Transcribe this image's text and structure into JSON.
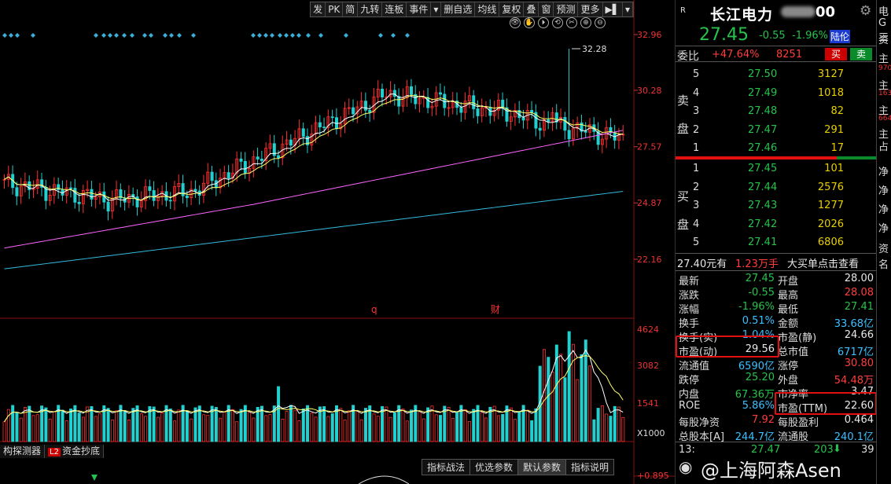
{
  "toolbar": {
    "buttons": [
      "发",
      "PK",
      "简",
      "九转",
      "连板",
      "事件",
      "▾",
      "删自选",
      "均线",
      "复权",
      "叠",
      "窗",
      "预测",
      "更多",
      "▶▌",
      "▾"
    ]
  },
  "mini_tools": [
    "👁",
    "✋",
    "⏵",
    "⟲",
    "✂",
    "⊕",
    "⊖"
  ],
  "chart": {
    "price_axis": [
      "32.96",
      "30.28",
      "27.57",
      "24.87",
      "22.16"
    ],
    "peak_label": "32.28",
    "event_markers": [
      "q",
      "财"
    ],
    "volume_axis": [
      "4624",
      "3082",
      "1541",
      "X1000"
    ],
    "sub_axis": [
      "+0.895"
    ],
    "colors": {
      "up": "#ff3030",
      "down": "#22d0d0",
      "ma5": "#ffffff",
      "ma10": "#ffff66",
      "ma60": "#ff66ff",
      "ma250": "#33bbdd"
    }
  },
  "bottom_tabs": {
    "tab1": "构探测器",
    "l2_badge": "L2",
    "tab2": "资金抄底",
    "indicator": [
      "指标战法",
      "优选参数",
      "默认参数",
      "指标说明"
    ]
  },
  "quote": {
    "badge": "R",
    "name": "长江电力",
    "code_tail": "00",
    "price": "27.45",
    "change": "-0.55",
    "change_pct": "-1.96%",
    "market_tag": "陆伦",
    "weibi_label": "委比",
    "weibi": "+47.64%",
    "weicha": "8251",
    "buy_btn": "买",
    "sell_btn": "卖",
    "sell_side_label": [
      "卖",
      "盘"
    ],
    "buy_side_label": [
      "买",
      "盘"
    ],
    "asks": [
      {
        "lvl": "5",
        "price": "27.50",
        "vol": "3127"
      },
      {
        "lvl": "4",
        "price": "27.49",
        "vol": "1018"
      },
      {
        "lvl": "3",
        "price": "27.48",
        "vol": "82"
      },
      {
        "lvl": "2",
        "price": "27.47",
        "vol": "291"
      },
      {
        "lvl": "1",
        "price": "27.46",
        "vol": "17"
      }
    ],
    "bids": [
      {
        "lvl": "1",
        "price": "27.45",
        "vol": "101"
      },
      {
        "lvl": "2",
        "price": "27.44",
        "vol": "2576"
      },
      {
        "lvl": "3",
        "price": "27.43",
        "vol": "1277"
      },
      {
        "lvl": "4",
        "price": "27.42",
        "vol": "2026"
      },
      {
        "lvl": "5",
        "price": "27.41",
        "vol": "6806"
      }
    ],
    "big_order": {
      "price": "27.40元有",
      "amount": "1.23万手",
      "hint": "大买单点击查看"
    },
    "stats": [
      {
        "l": "最新",
        "lv": "27.45",
        "lc": "green",
        "r": "开盘",
        "rv": "28.00",
        "rc": "white"
      },
      {
        "l": "涨跌",
        "lv": "-0.55",
        "lc": "green",
        "r": "最高",
        "rv": "28.08",
        "rc": "red"
      },
      {
        "l": "涨幅",
        "lv": "-1.96%",
        "lc": "green",
        "r": "最低",
        "rv": "27.41",
        "rc": "green"
      },
      {
        "l": "换手",
        "lv": "0.51%",
        "lc": "cyan",
        "r": "金额",
        "rv": "33.68亿",
        "rc": "cyan"
      },
      {
        "l": "换手(实)",
        "lv": "1.04%",
        "lc": "cyan",
        "r": "市盈(静)",
        "rv": "24.66",
        "rc": "white"
      },
      {
        "l": "市盈(动)",
        "lv": "29.56",
        "lc": "white",
        "r": "总市值",
        "rv": "6717亿",
        "rc": "cyan"
      },
      {
        "l": "流通值",
        "lv": "6590亿",
        "lc": "cyan",
        "r": "涨停",
        "rv": "30.80",
        "rc": "red"
      },
      {
        "l": "跌停",
        "lv": "25.20",
        "lc": "green",
        "r": "外盘",
        "rv": "54.48万",
        "rc": "red"
      },
      {
        "l": "内盘",
        "lv": "67.36万",
        "lc": "green",
        "r": "市净率",
        "rv": "3.47",
        "rc": "white"
      },
      {
        "l": "ROE",
        "lv": "5.86%",
        "lc": "cyan",
        "r": "市盈(TTM)",
        "rv": "22.60",
        "rc": "white"
      },
      {
        "l": "每股净资",
        "lv": "7.92",
        "lc": "red",
        "r": "每股盈利",
        "rv": "0.464",
        "rc": "white"
      },
      {
        "l": "总股本[A]",
        "lv": "244.7亿",
        "lc": "cyan",
        "r": "流通股",
        "rv": "240.1亿",
        "rc": "cyan"
      }
    ],
    "tick": {
      "time": "13:",
      "price": "27.47",
      "vol": "203",
      "extra": "39"
    }
  },
  "watermark": "@上海阿森Asen",
  "edge_strip": [
    "电",
    "G三",
    "资",
    "主",
    "970",
    "主",
    "163",
    "主",
    "664",
    "主",
    "占",
    "净",
    "净",
    "净",
    "净",
    "资",
    "名"
  ]
}
